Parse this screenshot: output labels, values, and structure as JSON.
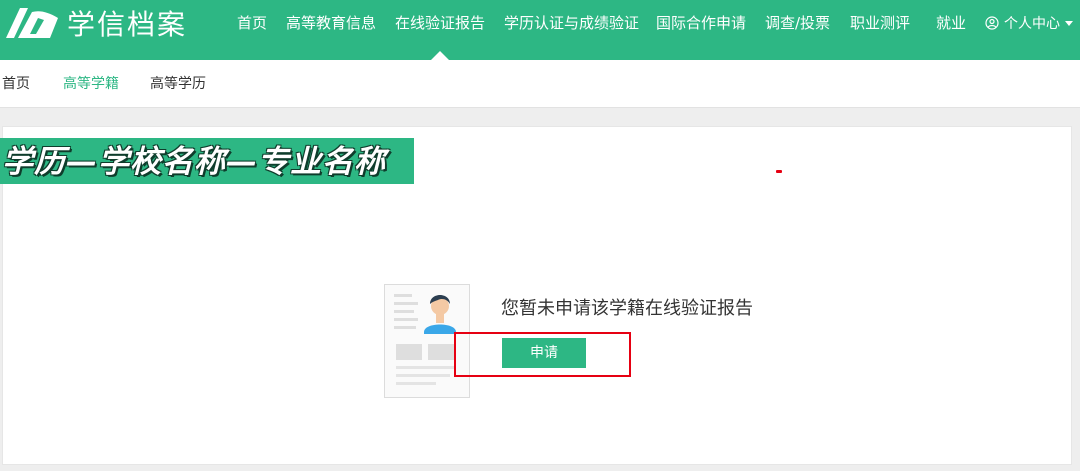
{
  "header": {
    "brand": "学信档案",
    "nav": [
      {
        "label": "首页"
      },
      {
        "label": "高等教育信息"
      },
      {
        "label": "在线验证报告"
      },
      {
        "label": "学历认证与成绩验证"
      },
      {
        "label": "国际合作申请"
      },
      {
        "label": "调查/投票"
      },
      {
        "label": "职业测评"
      },
      {
        "label": "就业"
      }
    ],
    "active_nav": "在线验证报告",
    "user_center": "个人中心"
  },
  "subnav": {
    "items": [
      {
        "label": "首页"
      },
      {
        "label": "高等学籍"
      },
      {
        "label": "高等学历"
      }
    ],
    "active": "高等学籍"
  },
  "banner": {
    "text": "学历—学校名称—专业名称"
  },
  "empty_state": {
    "message": "您暂未申请该学籍在线验证报告",
    "apply_label": "申请"
  },
  "colors": {
    "brand_green": "#2db784",
    "highlight_red": "#e60012"
  }
}
